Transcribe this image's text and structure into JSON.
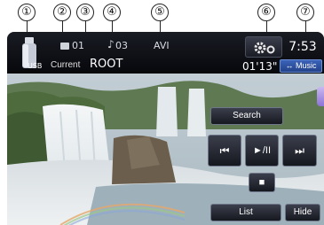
{
  "callouts": [
    "①",
    "②",
    "③",
    "④",
    "⑤",
    "⑥",
    "⑦"
  ],
  "status": {
    "source_label": "USB",
    "folder_number": "01",
    "track_number": "03",
    "format": "AVI",
    "current_label": "Current",
    "folder_name": "ROOT",
    "clock": "7:53",
    "elapsed_time": "01'13\"",
    "music_button": "↔ Music"
  },
  "controls": {
    "search": "Search",
    "prev": "⏮",
    "play_pause": "►/II",
    "next": "⏭",
    "stop": "■",
    "list": "List",
    "hide": "Hide"
  },
  "icons": {
    "usb": "usb-icon",
    "folder": "folder-icon",
    "note": "note-icon",
    "settings": "gear-icon"
  }
}
